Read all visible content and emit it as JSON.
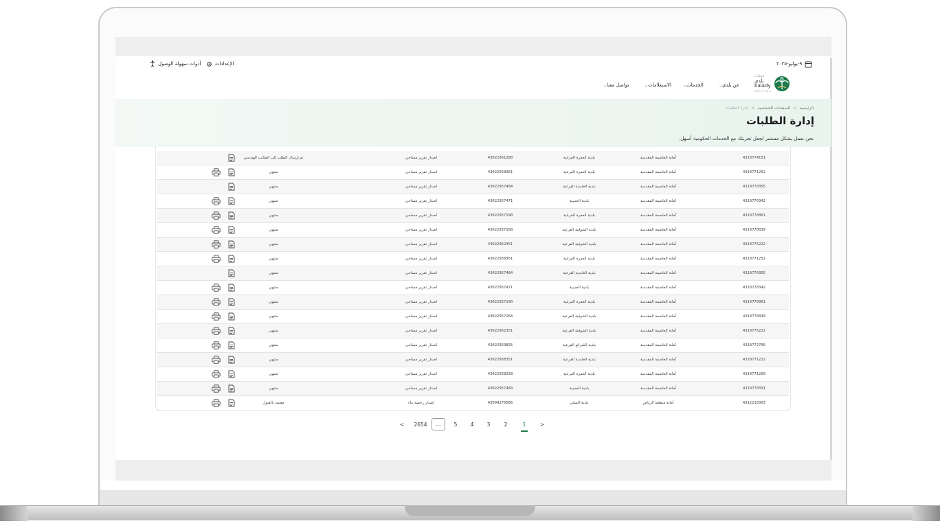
{
  "topbar": {
    "date": "٩-يوليو-٢٠٢٥",
    "settings": "الإعدادات",
    "accessibility": "أدوات سهولة الوصول"
  },
  "brand": {
    "name_ar": "بلدي",
    "small_ar": "خدمات",
    "name_en": "balady",
    "tag_en": "services"
  },
  "nav": {
    "items": [
      {
        "label": "عن بلدي"
      },
      {
        "label": "الخدمات"
      },
      {
        "label": "الاستعلامات"
      },
      {
        "label": "تواصل معنا"
      }
    ]
  },
  "breadcrumb": {
    "items": [
      "الرئيسية",
      "الصفحات الشخصية",
      "إدارة الطلبات"
    ]
  },
  "page": {
    "title": "إدارة الطلبات",
    "subtitle": "نحن نعمل بشكل مستمر لجعل تجربتك مع الخدمات الحكومية أسهل."
  },
  "table": {
    "rows": [
      {
        "num": "4310774151",
        "amana": "أمانة العاصمة المقدسة",
        "baladiya": "بلدية العمرة الفرعية",
        "ref": "43022961280",
        "service": "اصدار تقرير مساحي",
        "status": "تم إرسال الطلب إلى المكتب الهندسي",
        "doc": true,
        "print": false
      },
      {
        "num": "4310771252",
        "amana": "أمانة العاصمة المقدسة",
        "baladiya": "بلدية العمرة الفرعية",
        "ref": "43022958361",
        "service": "اصدار تقرير مساحي",
        "status": "منتهي",
        "doc": true,
        "print": true
      },
      {
        "num": "4310770355",
        "amana": "أمانة العاصمة المقدسة",
        "baladiya": "بلدية العابدية الفرعية",
        "ref": "43022957484",
        "service": "اصدار تقرير مساحي",
        "status": "منتهي",
        "doc": true,
        "print": false
      },
      {
        "num": "4310770342",
        "amana": "أمانة العاصمة المقدسة",
        "baladiya": "بلدية الجنيبية",
        "ref": "43022957471",
        "service": "اصدار تقرير مساحي",
        "status": "منتهي",
        "doc": true,
        "print": true
      },
      {
        "num": "4310770061",
        "amana": "أمانة العاصمة المقدسة",
        "baladiya": "بلدية العمرة الفرعية",
        "ref": "43022957190",
        "service": "اصدار تقرير مساحي",
        "status": "منتهي",
        "doc": true,
        "print": true
      },
      {
        "num": "4310770039",
        "amana": "أمانة العاصمة المقدسة",
        "baladiya": "بلدية الشوقية الفرعية",
        "ref": "43022957168",
        "service": "اصدار تقرير مساحي",
        "status": "منتهي",
        "doc": true,
        "print": true
      },
      {
        "num": "4310775222",
        "amana": "أمانة العاصمة المقدسة",
        "baladiya": "بلدية الشوقية الفرعية",
        "ref": "43022962351",
        "service": "اصدار تقرير مساحي",
        "status": "منتهي",
        "doc": true,
        "print": true
      },
      {
        "num": "4310771252",
        "amana": "أمانة العاصمة المقدسة",
        "baladiya": "بلدية العمرة الفرعية",
        "ref": "43022958361",
        "service": "اصدار تقرير مساحي",
        "status": "منتهي",
        "doc": true,
        "print": true
      },
      {
        "num": "4310770355",
        "amana": "أمانة العاصمة المقدسة",
        "baladiya": "بلدية العابدية الفرعية",
        "ref": "43022957484",
        "service": "اصدار تقرير مساحي",
        "status": "منتهي",
        "doc": true,
        "print": false
      },
      {
        "num": "4310770342",
        "amana": "أمانة العاصمة المقدسة",
        "baladiya": "بلدية الجنيبية",
        "ref": "43022957471",
        "service": "اصدار تقرير مساحي",
        "status": "منتهي",
        "doc": true,
        "print": true
      },
      {
        "num": "4310770061",
        "amana": "أمانة العاصمة المقدسة",
        "baladiya": "بلدية العمرة الفرعية",
        "ref": "43022957190",
        "service": "اصدار تقرير مساحي",
        "status": "منتهي",
        "doc": true,
        "print": true
      },
      {
        "num": "4310770039",
        "amana": "أمانة العاصمة المقدسة",
        "baladiya": "بلدية الشوقية الفرعية",
        "ref": "43022957168",
        "service": "اصدار تقرير مساحي",
        "status": "منتهي",
        "doc": true,
        "print": true
      },
      {
        "num": "4310775222",
        "amana": "أمانة العاصمة المقدسة",
        "baladiya": "بلدية الشوقية الفرعية",
        "ref": "43022962351",
        "service": "اصدار تقرير مساحي",
        "status": "منتهي",
        "doc": true,
        "print": true
      },
      {
        "num": "4310772766",
        "amana": "أمانة العاصمة المقدسة",
        "baladiya": "بلدية الشرائع الفرعية",
        "ref": "43022959895",
        "service": "اصدار تقرير مساحي",
        "status": "منتهي",
        "doc": true,
        "print": true
      },
      {
        "num": "4310771222",
        "amana": "أمانة العاصمة المقدسة",
        "baladiya": "بلدية العابدية الفرعية",
        "ref": "43022958351",
        "service": "اصدار تقرير مساحي",
        "status": "منتهي",
        "doc": true,
        "print": true
      },
      {
        "num": "4310771209",
        "amana": "أمانة العاصمة المقدسة",
        "baladiya": "بلدية العمرة الفرعية",
        "ref": "43022958338",
        "service": "اصدار تقرير مساحي",
        "status": "منتهي",
        "doc": true,
        "print": true
      },
      {
        "num": "4310770331",
        "amana": "أمانة العاصمة المقدسة",
        "baladiya": "بلدية الجنيبية",
        "ref": "43022957460",
        "service": "اصدار تقرير مساحي",
        "status": "منتهي",
        "doc": true,
        "print": true
      },
      {
        "num": "4312210303",
        "amana": "أمانة منطقة الرياض",
        "baladiya": "بلدية السلي",
        "ref": "43094276086",
        "service": "إصدار رخصة بناء",
        "status": "معتمد بالقبول",
        "doc": true,
        "print": true
      }
    ]
  },
  "pagination": {
    "prev": "<",
    "next": ">",
    "pages": [
      "1",
      "2",
      "3",
      "4",
      "5"
    ],
    "ellipsis": "...",
    "last": "2654",
    "current": "1"
  },
  "colors": {
    "accent": "#1b7a4b",
    "hero_bg": "#eef6f1",
    "row_alt": "#f6f6f6"
  }
}
